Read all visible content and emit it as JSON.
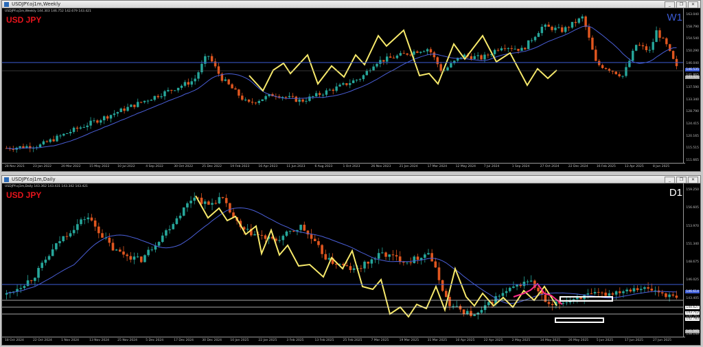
{
  "weekly": {
    "window_title": "USDJPY.oj1m,Weekly",
    "info": "USDJPY.oj1m,Weekly 144.303 146.752 142.679 143.421",
    "symbol": "USD JPY",
    "timeframe": "W1",
    "price_ticks": [
      "163.040",
      "158.790",
      "154.540",
      "150.290",
      "146.040",
      "141.865",
      "137.590",
      "133.340",
      "128.790",
      "124.415",
      "120.165",
      "115.515",
      "111.665"
    ],
    "levels": [
      {
        "label": "146.535",
        "color": "#3b5bd6"
      },
      {
        "label": "143.421",
        "color": "#aaaaaa"
      }
    ],
    "dates": [
      "28 Nov 2021",
      "23 Jan 2022",
      "20 Mar 2022",
      "15 May 2022",
      "10 Jul 2022",
      "4 Sep 2022",
      "30 Oct 2022",
      "25 Dec 2022",
      "19 Feb 2023",
      "16 Apr 2023",
      "11 Jun 2023",
      "6 Aug 2023",
      "1 Oct 2023",
      "26 Nov 2023",
      "21 Jan 2024",
      "17 Mar 2024",
      "12 May 2024",
      "7 Jul 2024",
      "1 Sep 2024",
      "27 Oct 2024",
      "22 Dec 2024",
      "16 Feb 2025",
      "13 Apr 2025",
      "8 Jun 2025"
    ]
  },
  "daily": {
    "window_title": "USDJPY.oj1m,Daily",
    "info": "USDJPY.oj1m,Daily 143.362 143.431 143.342 143.421",
    "symbol": "USD JPY",
    "timeframe": "D1",
    "price_ticks": [
      "159.250",
      "156.605",
      "153.970",
      "151.340",
      "148.675",
      "146.025",
      "143.405",
      "140.765",
      "138.140"
    ],
    "levels": [
      {
        "label": "146.614",
        "color": "#3b5bd6"
      },
      {
        "label": "144.627",
        "color": "#ffffff"
      },
      {
        "label": "143.712",
        "color": "#ffffff"
      },
      {
        "label": "142.783",
        "color": "#ffffff"
      },
      {
        "label": "141.565",
        "color": "#aaaaaa"
      }
    ],
    "dates": [
      "18 Oct 2024",
      "22 Oct 2024",
      "1 Nov 2024",
      "13 Nov 2024",
      "25 Nov 2024",
      "5 Dec 2024",
      "17 Dec 2024",
      "30 Dec 2024",
      "10 Jan 2025",
      "22 Jan 2025",
      "3 Feb 2025",
      "13 Feb 2025",
      "25 Feb 2025",
      "7 Mar 2025",
      "19 Mar 2025",
      "31 Mar 2025",
      "10 Apr 2025",
      "22 Apr 2025",
      "2 May 2025",
      "14 May 2025",
      "26 May 2025",
      "5 Jun 2025",
      "17 Jun 2025",
      "27 Jun 2025"
    ]
  },
  "colors": {
    "bull": "#26a69a",
    "bear": "#e0561f",
    "ma": "#4a5fd8",
    "zigzag": "#f7e96b",
    "zigzag_pink": "#ff2d8a",
    "title_red": "#e8141c",
    "tf_weekly": "#3b5bd6",
    "tf_daily": "#ffffff"
  },
  "icons": {
    "minimize": "minimize-icon",
    "restore": "restore-icon",
    "close": "close-icon"
  },
  "window_buttons": {
    "minimize": "_",
    "restore": "❐",
    "close": "✕"
  }
}
